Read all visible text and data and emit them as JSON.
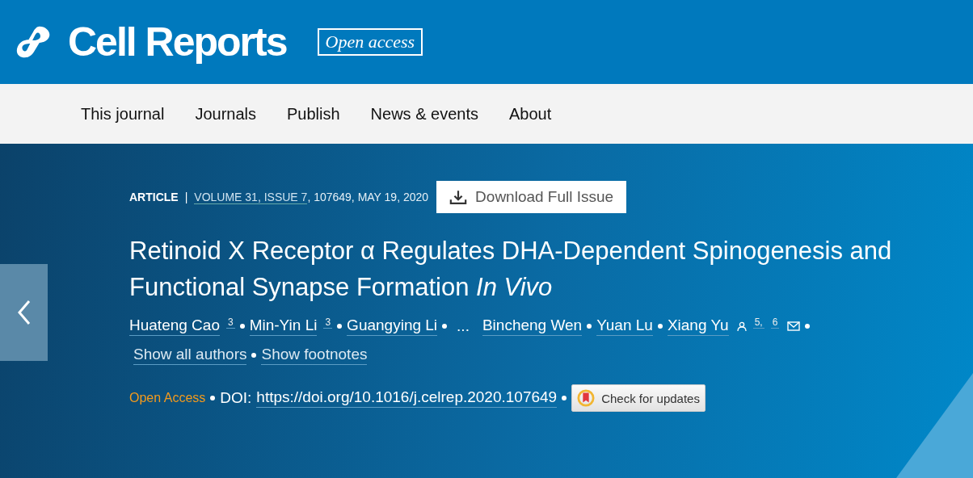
{
  "header": {
    "logo_text": "Cell Reports",
    "badge": "Open access"
  },
  "nav": {
    "items": [
      "This journal",
      "Journals",
      "Publish",
      "News & events",
      "About"
    ]
  },
  "article": {
    "type": "ARTICLE",
    "separator": "|",
    "volume_link": "VOLUME 31, ISSUE 7",
    "citation": ", 107649, MAY 19, 2020",
    "download_button": "Download Full Issue",
    "title": "Retinoid X Receptor α Regulates DHA-Dependent Spinogenesis and Functional Synapse Formation *In Vivo*",
    "authors": [
      {
        "kind": "author",
        "name": "Huateng Cao",
        "footnotes": [
          "3"
        ]
      },
      {
        "kind": "author",
        "name": "Min-Yin Li",
        "footnotes": [
          "3"
        ]
      },
      {
        "kind": "author",
        "name": "Guangying Li"
      },
      {
        "kind": "ellipsis",
        "name": "..."
      },
      {
        "kind": "author",
        "name": "Bincheng Wen"
      },
      {
        "kind": "author",
        "name": "Yuan Lu"
      },
      {
        "kind": "author",
        "name": "Xiang Yu",
        "corresponding": true,
        "footnotes": [
          "5,",
          "6"
        ],
        "email": true
      }
    ],
    "author_links": [
      "Show all authors",
      "Show footnotes"
    ],
    "access_label": "Open Access",
    "doi_label": "DOI:",
    "doi": "https://doi.org/10.1016/j.celrep.2020.107649",
    "check_updates": "Check for updates"
  }
}
